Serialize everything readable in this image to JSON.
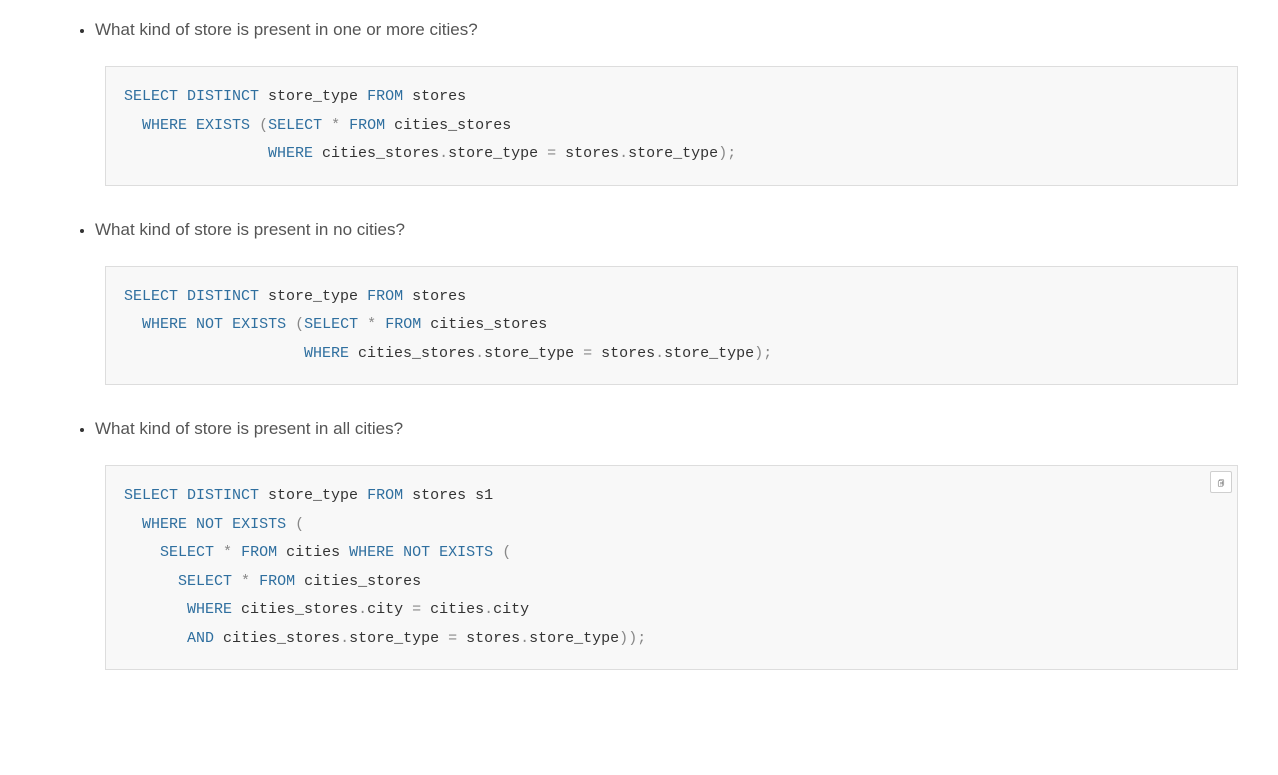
{
  "items": [
    {
      "question": "What kind of store is present in one or more cities?",
      "showCopy": false,
      "tokens": [
        {
          "t": "SELECT",
          "c": "kw"
        },
        {
          "t": " "
        },
        {
          "t": "DISTINCT",
          "c": "kw"
        },
        {
          "t": " store_type ",
          "c": "id"
        },
        {
          "t": "FROM",
          "c": "kw"
        },
        {
          "t": " stores",
          "c": "id"
        },
        {
          "t": "\n"
        },
        {
          "t": "  "
        },
        {
          "t": "WHERE",
          "c": "kw"
        },
        {
          "t": " "
        },
        {
          "t": "EXISTS",
          "c": "kw"
        },
        {
          "t": " "
        },
        {
          "t": "(",
          "c": "op"
        },
        {
          "t": "SELECT",
          "c": "kw"
        },
        {
          "t": " "
        },
        {
          "t": "*",
          "c": "op"
        },
        {
          "t": " "
        },
        {
          "t": "FROM",
          "c": "kw"
        },
        {
          "t": " cities_stores",
          "c": "id"
        },
        {
          "t": "\n"
        },
        {
          "t": "                "
        },
        {
          "t": "WHERE",
          "c": "kw"
        },
        {
          "t": " cities_stores",
          "c": "id"
        },
        {
          "t": ".",
          "c": "op"
        },
        {
          "t": "store_type ",
          "c": "id"
        },
        {
          "t": "=",
          "c": "op"
        },
        {
          "t": " stores",
          "c": "id"
        },
        {
          "t": ".",
          "c": "op"
        },
        {
          "t": "store_type",
          "c": "id"
        },
        {
          "t": ")",
          "c": "op"
        },
        {
          "t": ";",
          "c": "op"
        }
      ]
    },
    {
      "question": "What kind of store is present in no cities?",
      "showCopy": false,
      "tokens": [
        {
          "t": "SELECT",
          "c": "kw"
        },
        {
          "t": " "
        },
        {
          "t": "DISTINCT",
          "c": "kw"
        },
        {
          "t": " store_type ",
          "c": "id"
        },
        {
          "t": "FROM",
          "c": "kw"
        },
        {
          "t": " stores",
          "c": "id"
        },
        {
          "t": "\n"
        },
        {
          "t": "  "
        },
        {
          "t": "WHERE",
          "c": "kw"
        },
        {
          "t": " "
        },
        {
          "t": "NOT",
          "c": "kw"
        },
        {
          "t": " "
        },
        {
          "t": "EXISTS",
          "c": "kw"
        },
        {
          "t": " "
        },
        {
          "t": "(",
          "c": "op"
        },
        {
          "t": "SELECT",
          "c": "kw"
        },
        {
          "t": " "
        },
        {
          "t": "*",
          "c": "op"
        },
        {
          "t": " "
        },
        {
          "t": "FROM",
          "c": "kw"
        },
        {
          "t": " cities_stores",
          "c": "id"
        },
        {
          "t": "\n"
        },
        {
          "t": "                    "
        },
        {
          "t": "WHERE",
          "c": "kw"
        },
        {
          "t": " cities_stores",
          "c": "id"
        },
        {
          "t": ".",
          "c": "op"
        },
        {
          "t": "store_type ",
          "c": "id"
        },
        {
          "t": "=",
          "c": "op"
        },
        {
          "t": " stores",
          "c": "id"
        },
        {
          "t": ".",
          "c": "op"
        },
        {
          "t": "store_type",
          "c": "id"
        },
        {
          "t": ")",
          "c": "op"
        },
        {
          "t": ";",
          "c": "op"
        }
      ]
    },
    {
      "question": "What kind of store is present in all cities?",
      "showCopy": true,
      "tokens": [
        {
          "t": "SELECT",
          "c": "kw"
        },
        {
          "t": " "
        },
        {
          "t": "DISTINCT",
          "c": "kw"
        },
        {
          "t": " store_type ",
          "c": "id"
        },
        {
          "t": "FROM",
          "c": "kw"
        },
        {
          "t": " stores s1",
          "c": "id"
        },
        {
          "t": "\n"
        },
        {
          "t": "  "
        },
        {
          "t": "WHERE",
          "c": "kw"
        },
        {
          "t": " "
        },
        {
          "t": "NOT",
          "c": "kw"
        },
        {
          "t": " "
        },
        {
          "t": "EXISTS",
          "c": "kw"
        },
        {
          "t": " "
        },
        {
          "t": "(",
          "c": "op"
        },
        {
          "t": "\n"
        },
        {
          "t": "    "
        },
        {
          "t": "SELECT",
          "c": "kw"
        },
        {
          "t": " "
        },
        {
          "t": "*",
          "c": "op"
        },
        {
          "t": " "
        },
        {
          "t": "FROM",
          "c": "kw"
        },
        {
          "t": " cities ",
          "c": "id"
        },
        {
          "t": "WHERE",
          "c": "kw"
        },
        {
          "t": " "
        },
        {
          "t": "NOT",
          "c": "kw"
        },
        {
          "t": " "
        },
        {
          "t": "EXISTS",
          "c": "kw"
        },
        {
          "t": " "
        },
        {
          "t": "(",
          "c": "op"
        },
        {
          "t": "\n"
        },
        {
          "t": "      "
        },
        {
          "t": "SELECT",
          "c": "kw"
        },
        {
          "t": " "
        },
        {
          "t": "*",
          "c": "op"
        },
        {
          "t": " "
        },
        {
          "t": "FROM",
          "c": "kw"
        },
        {
          "t": " cities_stores",
          "c": "id"
        },
        {
          "t": "\n"
        },
        {
          "t": "       "
        },
        {
          "t": "WHERE",
          "c": "kw"
        },
        {
          "t": " cities_stores",
          "c": "id"
        },
        {
          "t": ".",
          "c": "op"
        },
        {
          "t": "city ",
          "c": "id"
        },
        {
          "t": "=",
          "c": "op"
        },
        {
          "t": " cities",
          "c": "id"
        },
        {
          "t": ".",
          "c": "op"
        },
        {
          "t": "city",
          "c": "id"
        },
        {
          "t": "\n"
        },
        {
          "t": "       "
        },
        {
          "t": "AND",
          "c": "kw"
        },
        {
          "t": " cities_stores",
          "c": "id"
        },
        {
          "t": ".",
          "c": "op"
        },
        {
          "t": "store_type ",
          "c": "id"
        },
        {
          "t": "=",
          "c": "op"
        },
        {
          "t": " stores",
          "c": "id"
        },
        {
          "t": ".",
          "c": "op"
        },
        {
          "t": "store_type",
          "c": "id"
        },
        {
          "t": ")",
          "c": "op"
        },
        {
          "t": ")",
          "c": "op"
        },
        {
          "t": ";",
          "c": "op"
        }
      ]
    }
  ],
  "ui": {
    "copy_tooltip": "Copy"
  }
}
